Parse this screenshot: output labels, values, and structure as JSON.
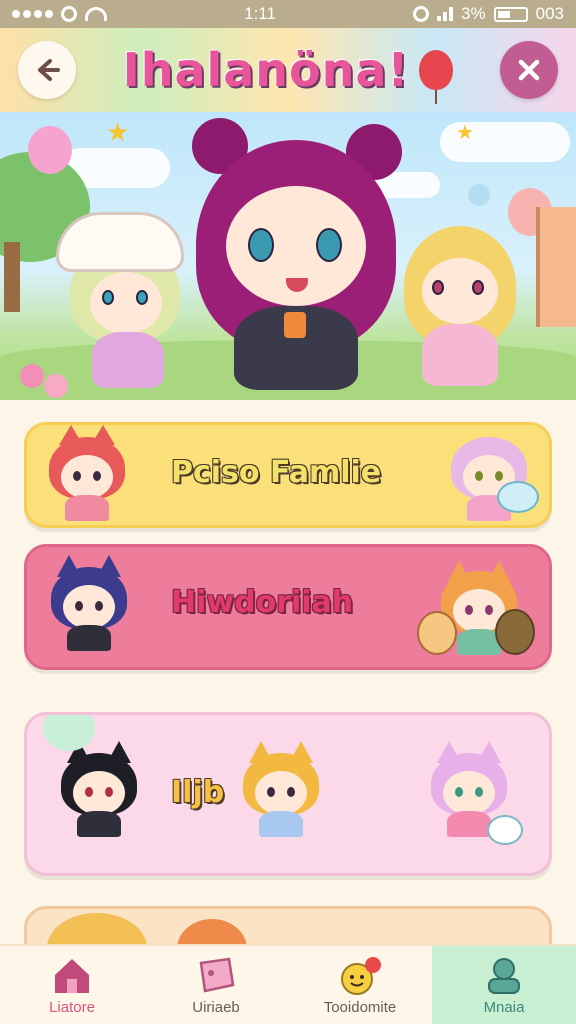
{
  "status_bar": {
    "time": "1:11",
    "battery_text": "3%",
    "extra_text": "003"
  },
  "header": {
    "title": "Ihalanöna!",
    "back_icon": "arrow-left-icon",
    "close_icon": "close-icon",
    "balloon_icon": "balloon-icon"
  },
  "cards": [
    {
      "label": "Pciso Famlie",
      "color": "#fbe07a"
    },
    {
      "label": "Hiwdoriiah",
      "color": "#ee7c9b"
    },
    {
      "label": "Iljb",
      "color": "#fbd9e8"
    },
    {
      "label": "",
      "color": "#fbe3c6"
    }
  ],
  "bottom_nav": {
    "items": [
      {
        "label": "Liatore",
        "icon": "house-icon",
        "active": false
      },
      {
        "label": "Uiriaeb",
        "icon": "tag-icon",
        "active": false
      },
      {
        "label": "Tooidomite",
        "icon": "smiley-icon",
        "active": false
      },
      {
        "label": "Mnaia",
        "icon": "profile-icon",
        "active": true
      }
    ]
  },
  "colors": {
    "accent_pink": "#e8559a",
    "close_button": "#c25d93",
    "nav_active": "#c8efd2"
  }
}
